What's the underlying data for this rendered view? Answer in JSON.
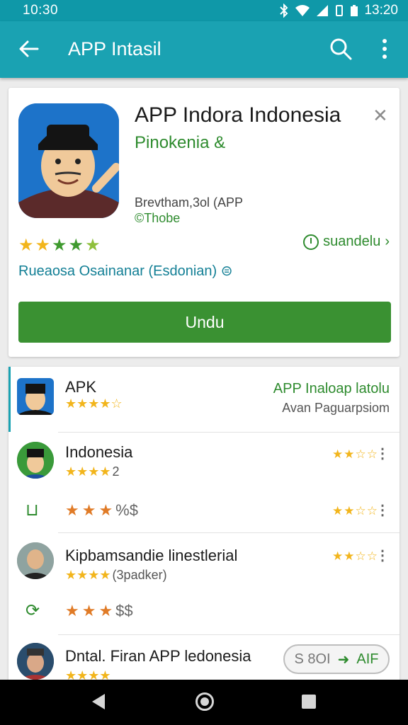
{
  "status_bar": {
    "time_left": "10:30",
    "time_right": "13:20",
    "icons": [
      "bluetooth-icon",
      "wifi-icon",
      "signal-icon",
      "vibrate-icon",
      "battery-icon"
    ]
  },
  "app_bar": {
    "title": "APP Intasil",
    "icons": [
      "back-arrow-icon",
      "search-icon",
      "more-vert-icon"
    ]
  },
  "detail_card": {
    "app_name": "APP Indora Indonesia",
    "developer": "Pinokenia &",
    "info_line_1": "Brevtham,3ol (APP",
    "info_line_2": "©Thobe",
    "rating_value": 4.5,
    "rating_stars": "★★★★★",
    "meta_link": "suandelu",
    "release": "Rueaosa Osainanar (Esdonian)",
    "install_label": "Undu",
    "accent_color": "#3a9132"
  },
  "list": {
    "promo": {
      "name": "APK",
      "stars": "★★★★☆",
      "title": "APP Inaloap latolu",
      "subtitle": "Avan Paguarpsiom"
    },
    "items": [
      {
        "name": "Indonesia",
        "stars": "★★★★",
        "count": "2",
        "right_stars": "★★☆☆",
        "sub_icon": "lock-icon",
        "sub_stars": "★★★",
        "sub_symbol": "%$",
        "sub_right_stars": "★★☆☆"
      },
      {
        "name": "Kipbamsandie linestlerial",
        "stars": "★★★★",
        "count": "(3padker)",
        "right_stars": "★★☆☆",
        "sub_icon": "refresh-icon",
        "sub_stars": "★★★",
        "sub_symbol": "$$"
      },
      {
        "name": "Dntal. Firan APP ledonesia",
        "stars": "★★★★",
        "pill_left": "S 8OI",
        "pill_right": "AIF"
      }
    ]
  },
  "nav_bar": {
    "buttons": [
      "back-icon",
      "home-icon",
      "recents-icon"
    ]
  }
}
